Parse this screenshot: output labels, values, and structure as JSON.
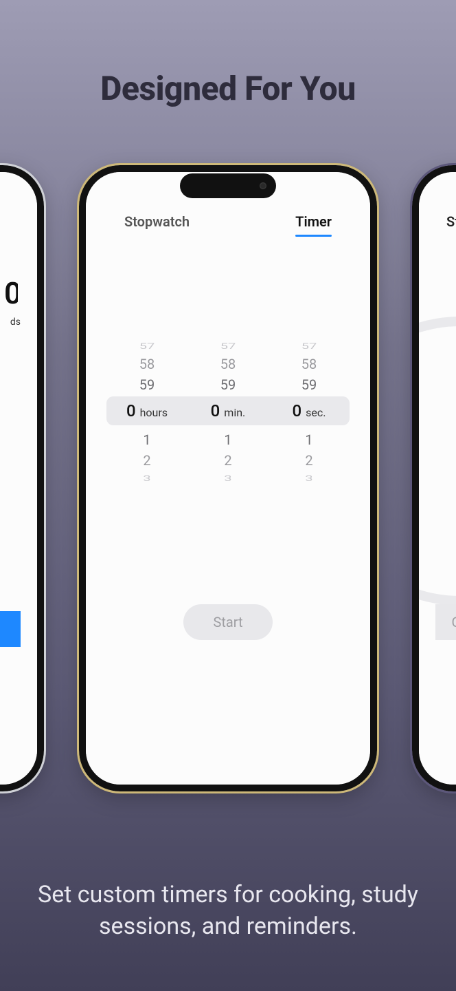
{
  "marketing": {
    "headline": "Designed For You",
    "caption": "Set custom timers for cooking, study sessions, and reminders."
  },
  "center": {
    "tabs": {
      "stopwatch_label": "Stopwatch",
      "timer_label": "Timer"
    },
    "picker": {
      "hours": {
        "sel": "0",
        "label": "hours"
      },
      "minutes": {
        "sel": "0",
        "label": "min."
      },
      "seconds": {
        "sel": "0",
        "label": "sec."
      },
      "above": [
        "57",
        "58",
        "59"
      ],
      "below": [
        "1",
        "2",
        "3"
      ]
    },
    "start_label": "Start"
  },
  "left": {
    "zero": "0",
    "unit_fragment": "ds"
  },
  "right": {
    "tab_fragment": "St",
    "cancel_fragment": "C"
  },
  "colors": {
    "accent": "#1e88ff"
  }
}
